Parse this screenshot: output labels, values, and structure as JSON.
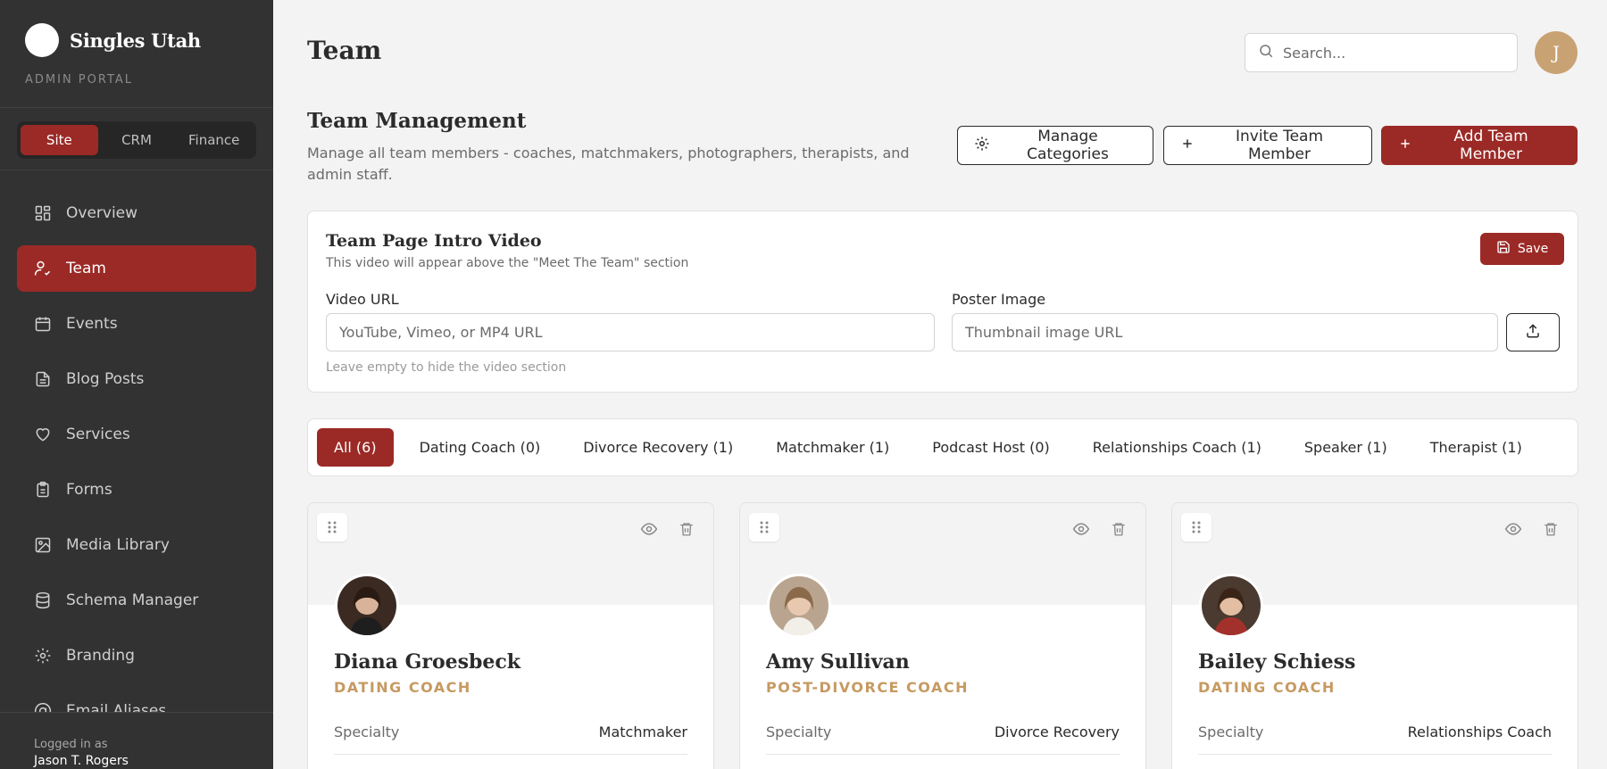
{
  "sidebar": {
    "brand": "Singles Utah",
    "subtitle": "ADMIN PORTAL",
    "switcher": [
      "Site",
      "CRM",
      "Finance"
    ],
    "nav": [
      {
        "label": "Overview",
        "icon": "grid-icon"
      },
      {
        "label": "Team",
        "icon": "user-check-icon"
      },
      {
        "label": "Events",
        "icon": "calendar-icon"
      },
      {
        "label": "Blog Posts",
        "icon": "document-icon"
      },
      {
        "label": "Services",
        "icon": "heart-icon"
      },
      {
        "label": "Forms",
        "icon": "clipboard-icon"
      },
      {
        "label": "Media Library",
        "icon": "image-icon"
      },
      {
        "label": "Schema Manager",
        "icon": "database-icon"
      },
      {
        "label": "Branding",
        "icon": "gear-icon"
      },
      {
        "label": "Email Aliases",
        "icon": "at-icon"
      }
    ],
    "footer_label": "Logged in as",
    "footer_user": "Jason T. Rogers"
  },
  "header": {
    "title": "Team",
    "search_placeholder": "Search...",
    "avatar_initial": "J"
  },
  "management": {
    "title": "Team Management",
    "description": "Manage all team members - coaches, matchmakers, photographers, therapists, and admin staff.",
    "manage_categories": "Manage Categories",
    "invite": "Invite Team Member",
    "add": "Add Team Member"
  },
  "video": {
    "title": "Team Page Intro Video",
    "subtitle": "This video will appear above the \"Meet The Team\" section",
    "save": "Save",
    "url_label": "Video URL",
    "url_placeholder": "YouTube, Vimeo, or MP4 URL",
    "poster_label": "Poster Image",
    "poster_placeholder": "Thumbnail image URL",
    "hint": "Leave empty to hide the video section"
  },
  "filters": [
    "All (6)",
    "Dating Coach (0)",
    "Divorce Recovery (1)",
    "Matchmaker (1)",
    "Podcast Host (0)",
    "Relationships Coach (1)",
    "Speaker (1)",
    "Therapist (1)"
  ],
  "members": [
    {
      "name": "Diana Groesbeck",
      "role": "DATING COACH",
      "specialty_label": "Specialty",
      "specialty": "Matchmaker"
    },
    {
      "name": "Amy Sullivan",
      "role": "POST-DIVORCE COACH",
      "specialty_label": "Specialty",
      "specialty": "Divorce Recovery"
    },
    {
      "name": "Bailey Schiess",
      "role": "DATING COACH",
      "specialty_label": "Specialty",
      "specialty": "Relationships Coach"
    }
  ],
  "colors": {
    "accent": "#9b2a26",
    "gold": "#c69a62",
    "sidebar": "#323232"
  }
}
